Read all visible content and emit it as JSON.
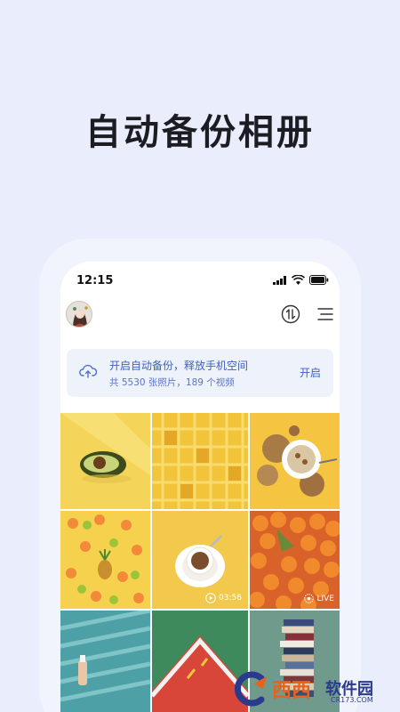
{
  "headline": "自动备份相册",
  "status_bar": {
    "time": "12:15"
  },
  "backup_banner": {
    "title": "开启自动备份，释放手机空间",
    "subtitle": "共 5530 张照片，189 个视频",
    "action_label": "开启"
  },
  "photos": [
    {
      "subject": "avocado"
    },
    {
      "subject": "yellow-chairs"
    },
    {
      "subject": "cereal-bowl"
    },
    {
      "subject": "citrus-slices"
    },
    {
      "subject": "coffee-cup",
      "badge": "03:56",
      "badge_icon": "play-icon"
    },
    {
      "subject": "oranges",
      "badge": "LIVE",
      "badge_icon": "live-icon"
    },
    {
      "subject": "bottle-shadow"
    },
    {
      "subject": "red-path"
    },
    {
      "subject": "stacked-books"
    }
  ],
  "watermark": {
    "main": "西西",
    "secondary": "软件园",
    "url": "CR173.COM"
  },
  "colors": {
    "accent": "#3e60c8",
    "background": "#e9edfc",
    "banner": "#eef2fb"
  }
}
